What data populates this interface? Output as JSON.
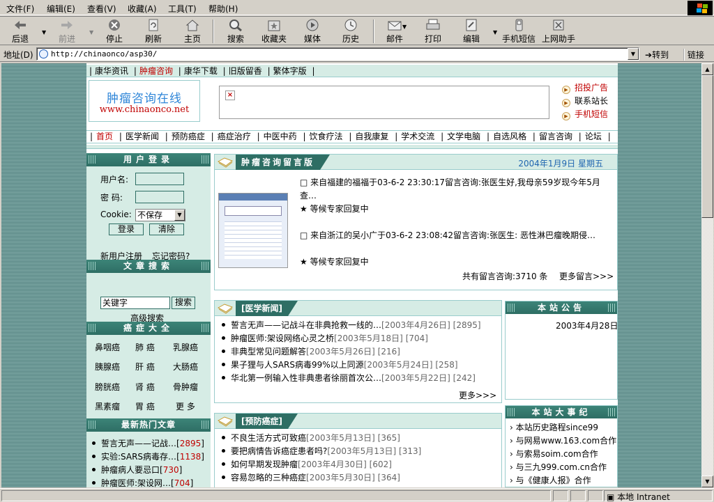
{
  "menu": [
    "文件(F)",
    "编辑(E)",
    "查看(V)",
    "收藏(A)",
    "工具(T)",
    "帮助(H)"
  ],
  "toolbar": {
    "back": "后退",
    "forward": "前进",
    "stop": "停止",
    "refresh": "刷新",
    "home": "主页",
    "search": "搜索",
    "favorites": "收藏夹",
    "media": "媒体",
    "history": "历史",
    "mail": "邮件",
    "print": "打印",
    "edit": "编辑",
    "sms": "手机短信",
    "helper": "上网助手"
  },
  "address": {
    "label": "地址(D)",
    "url": "http://chinaonco/asp30/",
    "go": "转到",
    "links": "链接"
  },
  "topnav": [
    "康华资讯",
    "肿瘤咨询",
    "康华下载",
    "旧版留香",
    "繁体字版"
  ],
  "logo": {
    "cn": "肿瘤咨询在线",
    "en": "www.chinaonco.net"
  },
  "ad": {
    "broken_mark": "×"
  },
  "side_links": [
    "招投广告",
    "联系站长",
    "手机短信"
  ],
  "mainnav": [
    "首页",
    "医学新闻",
    "预防癌症",
    "癌症治疗",
    "中医中药",
    "饮食疗法",
    "自我康复",
    "学术交流",
    "文学电脑",
    "自选风格",
    "留言咨询",
    "论坛"
  ],
  "login": {
    "title": "用户登录",
    "username_label": "用户名:",
    "password_label": "密  码:",
    "cookie_label": "Cookie:",
    "cookie_value": "不保存",
    "login_btn": "登录",
    "clear_btn": "清除",
    "register": "新用户注册",
    "forgot": "忘记密码?"
  },
  "article_search": {
    "title": "文章搜索",
    "placeholder": "关键字",
    "button": "搜索",
    "advanced": "高级搜索"
  },
  "cancers": {
    "title": "癌症大全",
    "items": [
      "鼻咽癌",
      "肺 癌",
      "乳腺癌",
      "胰腺癌",
      "肝 癌",
      "大肠癌",
      "膀胱癌",
      "肾 癌",
      "骨肿瘤",
      "黑素瘤",
      "胃 癌",
      "更 多"
    ]
  },
  "hot": {
    "title": "最新热门文章",
    "items": [
      {
        "text": "誓言无声——记战…",
        "count": "2895"
      },
      {
        "text": "实验:SARS病毒存…",
        "count": "1138"
      },
      {
        "text": "肿瘤病人要忌口",
        "count": "730"
      },
      {
        "text": "肿瘤医师:架设网…",
        "count": "704"
      }
    ]
  },
  "consult": {
    "title": "肿瘤咨询留言版",
    "date": "2004年1月9日 星期五",
    "messages": [
      {
        "text": "□ 来自福建的福福于03-6-2 23:30:17留言咨询:张医生好,我母亲59岁现今年5月查…",
        "reply": "★ 等候专家回复中"
      },
      {
        "text": "□ 来自浙江的吴小广于03-6-2 23:08:42留言咨询:张医生:   恶性淋巴瘤晚期侵…",
        "reply": "★ 等候专家回复中"
      }
    ],
    "total": "共有留言咨询:3710 条",
    "more": "更多留言>>>"
  },
  "med_news": {
    "title": "[医学新闻]",
    "items": [
      {
        "text": "誓言无声——记战斗在非典抢救一线的…",
        "date": "[2003年4月26日]",
        "count": "[2895]"
      },
      {
        "text": "肿瘤医师:架设网络心灵之桥",
        "date": "[2003年5月18日]",
        "count": "[704]"
      },
      {
        "text": "非典型常见问题解答",
        "date": "[2003年5月26日]",
        "count": "[216]"
      },
      {
        "text": "果子狸与人SARS病毒99%以上同源",
        "date": "[2003年5月24日]",
        "count": "[258]"
      },
      {
        "text": "华北第一例输入性非典患者徐丽首次公…",
        "date": "[2003年5月22日]",
        "count": "[242]"
      }
    ],
    "more": "更多>>>"
  },
  "prevention": {
    "title": "[预防癌症]",
    "items": [
      {
        "text": "不良生活方式可致癌",
        "date": "[2003年5月13日]",
        "count": "[365]"
      },
      {
        "text": "要把病情告诉癌症患者吗?",
        "date": "[2003年5月13日]",
        "count": "[313]"
      },
      {
        "text": "如何早期发现肿瘤",
        "date": "[2003年4月30日]",
        "count": "[602]"
      },
      {
        "text": "容易忽略的三种癌症",
        "date": "[2003年5月30日]",
        "count": "[364]"
      }
    ]
  },
  "notice": {
    "title": "本站公告",
    "date": "2003年4月28日"
  },
  "events": {
    "title": "本站大事纪",
    "items": [
      "本站历史路程since99",
      "与网易www.163.com合作",
      "与索易soim.com合作",
      "与三九999.com.cn合作",
      "与《健康人报》合作"
    ]
  },
  "status": {
    "zone": "本地 Intranet"
  },
  "colors": {
    "accent": "#2e6e64",
    "panel": "#d6ece5",
    "link_red": "#c00000",
    "date_blue": "#2066b0"
  }
}
